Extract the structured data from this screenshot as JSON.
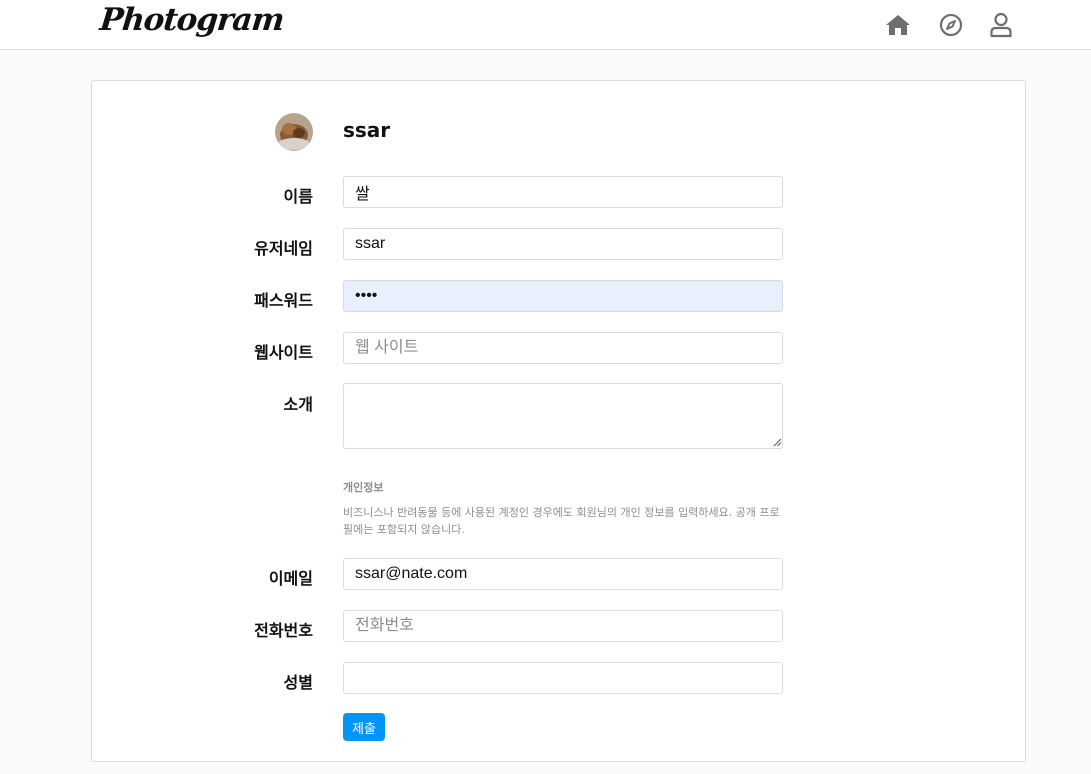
{
  "app": {
    "logo_text": "Photogram"
  },
  "nav": {
    "icons": [
      "home-icon",
      "compass-icon",
      "user-icon"
    ]
  },
  "profile": {
    "username": "ssar"
  },
  "form": {
    "name": {
      "label": "이름",
      "value": "쌀"
    },
    "username": {
      "label": "유저네임",
      "value": "ssar"
    },
    "password": {
      "label": "패스워드",
      "value": "1234"
    },
    "website": {
      "label": "웹사이트",
      "placeholder": "웹 사이트"
    },
    "bio": {
      "label": "소개"
    },
    "private_info": {
      "title": "개인정보",
      "description": "비즈니스나 반려동물 등에 사용된 계정인 경우에도 회원님의 개인 정보를 입력하세요. 공개 프로필에는 포함되지 않습니다."
    },
    "email": {
      "label": "이메일",
      "value": "ssar@nate.com"
    },
    "phone": {
      "label": "전화번호",
      "placeholder": "전화번호"
    },
    "gender": {
      "label": "성별"
    },
    "submit_label": "제출"
  },
  "colors": {
    "accent": "#0095f6",
    "autofill_bg": "#e8f0fe",
    "border": "#dbdbdb",
    "background": "#fafafa"
  }
}
